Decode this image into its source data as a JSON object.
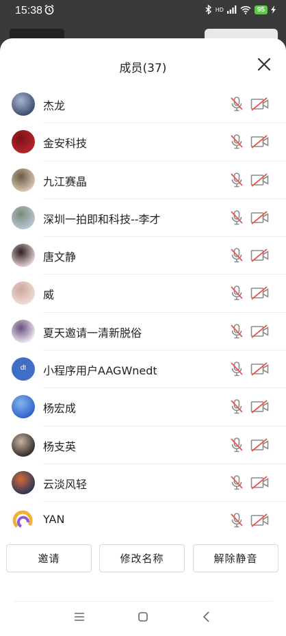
{
  "status": {
    "time": "15:38",
    "battery": "95",
    "network": "HD"
  },
  "panel": {
    "title": "成员(37)"
  },
  "members": [
    {
      "name": "杰龙",
      "avatar_colors": [
        "#3a4a6b",
        "#a9b6d0"
      ]
    },
    {
      "name": "金安科技",
      "avatar_colors": [
        "#b5252a",
        "#7a1218"
      ]
    },
    {
      "name": "九江赛晶",
      "avatar_colors": [
        "#d9c9b0",
        "#6b5a48"
      ]
    },
    {
      "name": "深圳一拍即和科技--李才",
      "avatar_colors": [
        "#b9c7d4",
        "#7c8a7a"
      ]
    },
    {
      "name": "唐文静",
      "avatar_colors": [
        "#e7d2d2",
        "#2d2020"
      ]
    },
    {
      "name": "威",
      "avatar_colors": [
        "#f0ddd6",
        "#c9a89a"
      ]
    },
    {
      "name": "夏天邀请一清新脱俗",
      "avatar_colors": [
        "#efe6f3",
        "#6a4f7a"
      ]
    },
    {
      "name": "小程序用户AAGWnedt",
      "avatar_colors": [
        "#3f6fc4",
        "#3f6fc4"
      ],
      "avatar_text": "dt"
    },
    {
      "name": "杨宏成",
      "avatar_colors": [
        "#2a62c9",
        "#86b4ee"
      ]
    },
    {
      "name": "杨支英",
      "avatar_colors": [
        "#2f2a28",
        "#c9b3a3"
      ]
    },
    {
      "name": "云淡风轻",
      "avatar_colors": [
        "#26355a",
        "#d66a3a"
      ]
    },
    {
      "name": "YAN",
      "avatar_colors": [
        "#ffffff",
        "#ffffff"
      ],
      "avatar_ring": true
    }
  ],
  "actions": {
    "invite": "邀请",
    "rename": "修改名称",
    "unmute": "解除静音"
  },
  "icons": {
    "close": "close-icon",
    "mic": "mic-muted-icon",
    "camera": "camera-off-icon",
    "menu": "menu-icon",
    "home": "home-icon",
    "back": "back-icon"
  },
  "colors": {
    "muted_red": "#e8544d",
    "icon_gray": "#8a8a8a"
  }
}
